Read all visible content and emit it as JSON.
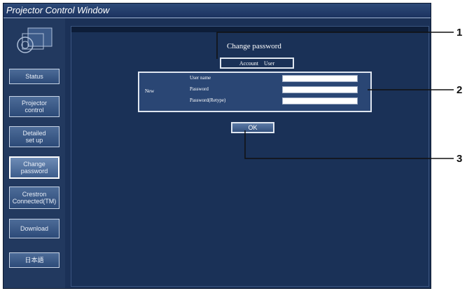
{
  "window": {
    "title": "Projector Control Window"
  },
  "sidebar": {
    "items": [
      {
        "label": "Status"
      },
      {
        "label": "Projector\ncontrol"
      },
      {
        "label": "Detailed\nset up"
      },
      {
        "label": "Change\npassword"
      },
      {
        "label": "Crestron\nConnected(TM)"
      },
      {
        "label": "Download"
      },
      {
        "label": "日本語"
      }
    ],
    "active_index": 3
  },
  "main": {
    "title": "Change password",
    "account": {
      "label": "Account",
      "value": "User"
    },
    "form": {
      "section_label": "New",
      "fields": [
        {
          "label": "User name",
          "value": ""
        },
        {
          "label": "Password",
          "value": ""
        },
        {
          "label": "Password(Retype)",
          "value": ""
        }
      ]
    },
    "ok_label": "OK"
  },
  "callouts": [
    "1",
    "2",
    "3"
  ],
  "colors": {
    "background": "#1b3157",
    "sidebar": "#22395f",
    "button": "#3d5d8c",
    "border": "#dfe6f0"
  }
}
